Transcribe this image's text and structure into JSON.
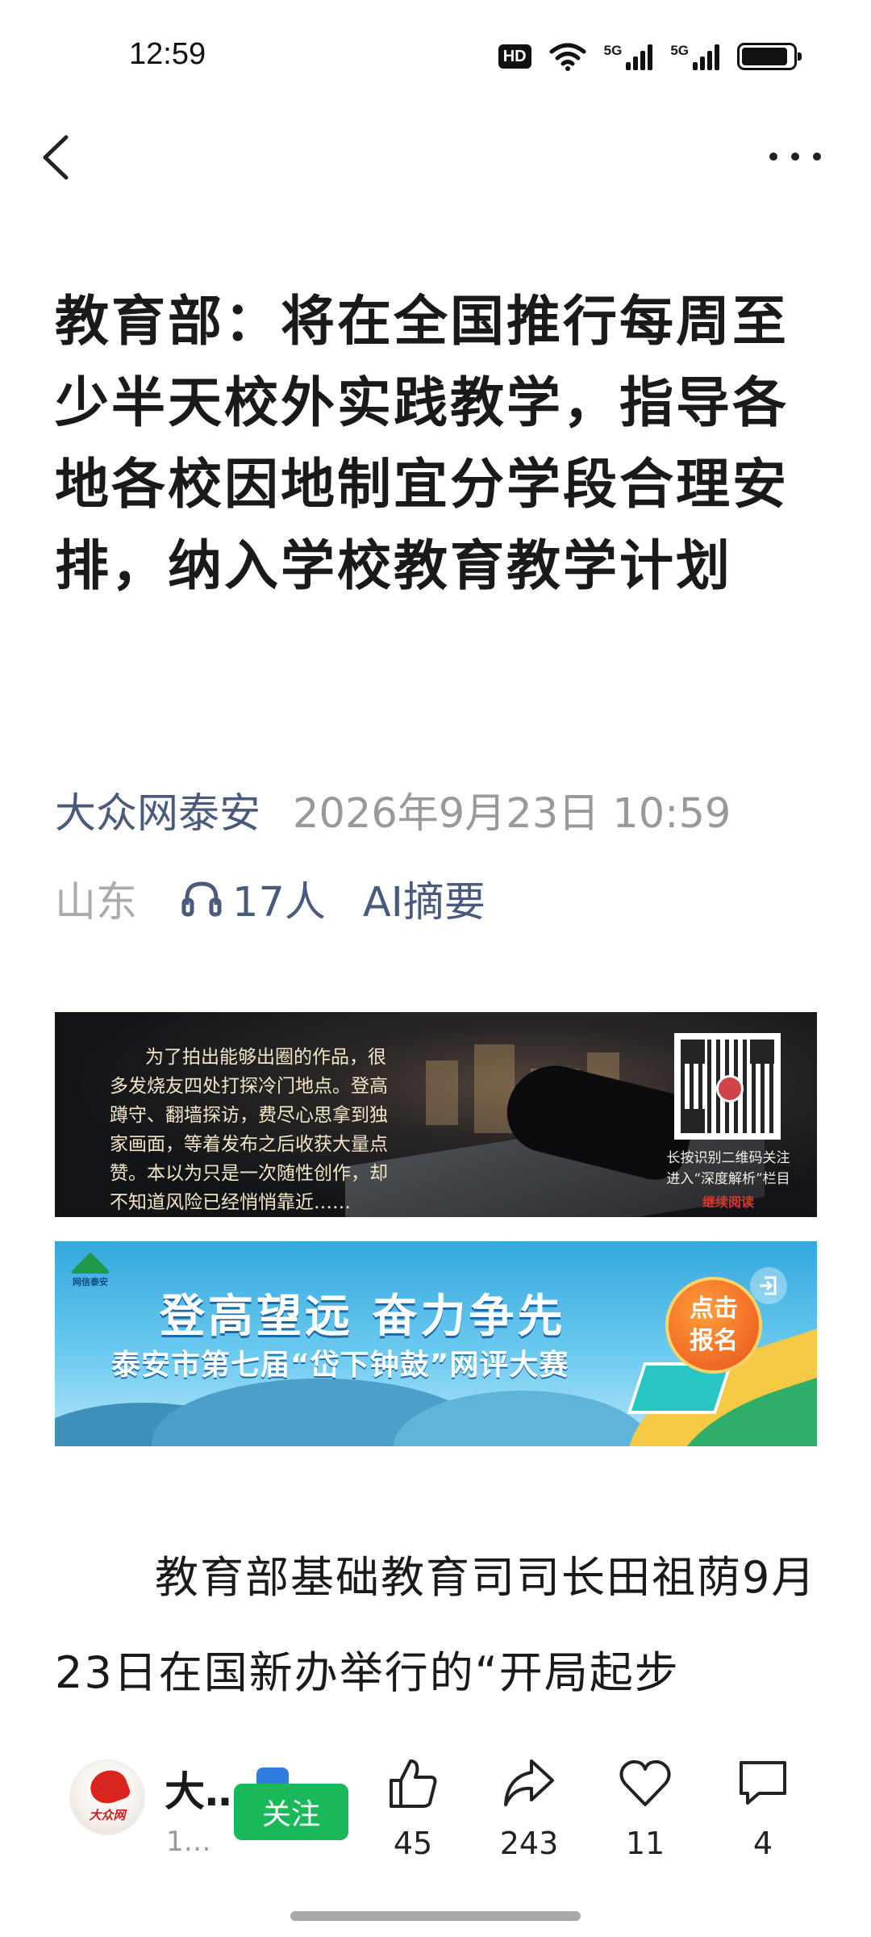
{
  "status_bar": {
    "time": "12:59",
    "hd_label": "HD",
    "network_1": "5G",
    "network_2": "5G",
    "battery_level": 0.9
  },
  "nav": {
    "back_icon": "chevron-left-icon",
    "more_icon": "more-horizontal-icon"
  },
  "article": {
    "title": "教育部：将在全国推行每周至少半天校外实践教学，指导各地各校因地制宜分学段合理安排，纳入学校教育教学计划",
    "source": "大众网泰安",
    "datetime": "2026年9月23日 10:59",
    "region": "山东",
    "listeners": "17人",
    "ai_summary": "AI摘要",
    "body": "教育部基础教育司司长田祖荫9月23日在国新办举行的“开局起步"
  },
  "banner_1": {
    "text": "为了拍出能够出圈的作品，很多发烧友四处打探冷门地点。登高蹲守、翻墙探访，费尽心思拿到独家画面，等着发布之后收获大量点赞。本以为只是一次随性创作，却不知道风险已经悄悄靠近……",
    "qr_caption_1": "长按识别二维码关注",
    "qr_caption_2": "进入“深度解析”栏目",
    "qr_more": "继续阅读"
  },
  "banner_2": {
    "logo_text": "网信泰安",
    "headline": "登高望远  奋力争先",
    "subline": "泰安市第七届“岱下钟鼓”网评大赛",
    "cta_line1": "点击",
    "cta_line2": "报名"
  },
  "bottom_bar": {
    "author_name": "大…",
    "author_sub": "1…",
    "avatar_text": "大众网",
    "follow_label": "关注",
    "like_count": "45",
    "share_count": "243",
    "favorite_count": "11",
    "comment_count": "4"
  },
  "colors": {
    "accent_text": "#4a5a7c",
    "follow_green": "#19b95a",
    "banner_blue": "#34a8de"
  }
}
